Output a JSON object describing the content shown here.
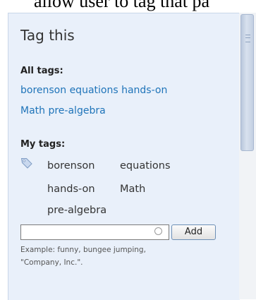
{
  "page": {
    "top_text": "allow user to tag that pa"
  },
  "panel": {
    "title": "Tag this",
    "all_tags": {
      "label": "All tags:",
      "lines": [
        "borenson equations hands-on",
        "Math pre-algebra"
      ]
    },
    "my_tags": {
      "label": "My tags:",
      "icon": "tag-icon",
      "tags": [
        "borenson",
        "equations",
        "hands-on",
        "Math",
        "pre-algebra"
      ]
    },
    "add_form": {
      "input_value": "",
      "button_label": "Add",
      "hint_lines": [
        "Example: funny, bungee jumping,",
        "\"Company, Inc.\"."
      ]
    }
  },
  "colors": {
    "link": "#1f74b9",
    "panel_bg": "#e9f0fa"
  }
}
